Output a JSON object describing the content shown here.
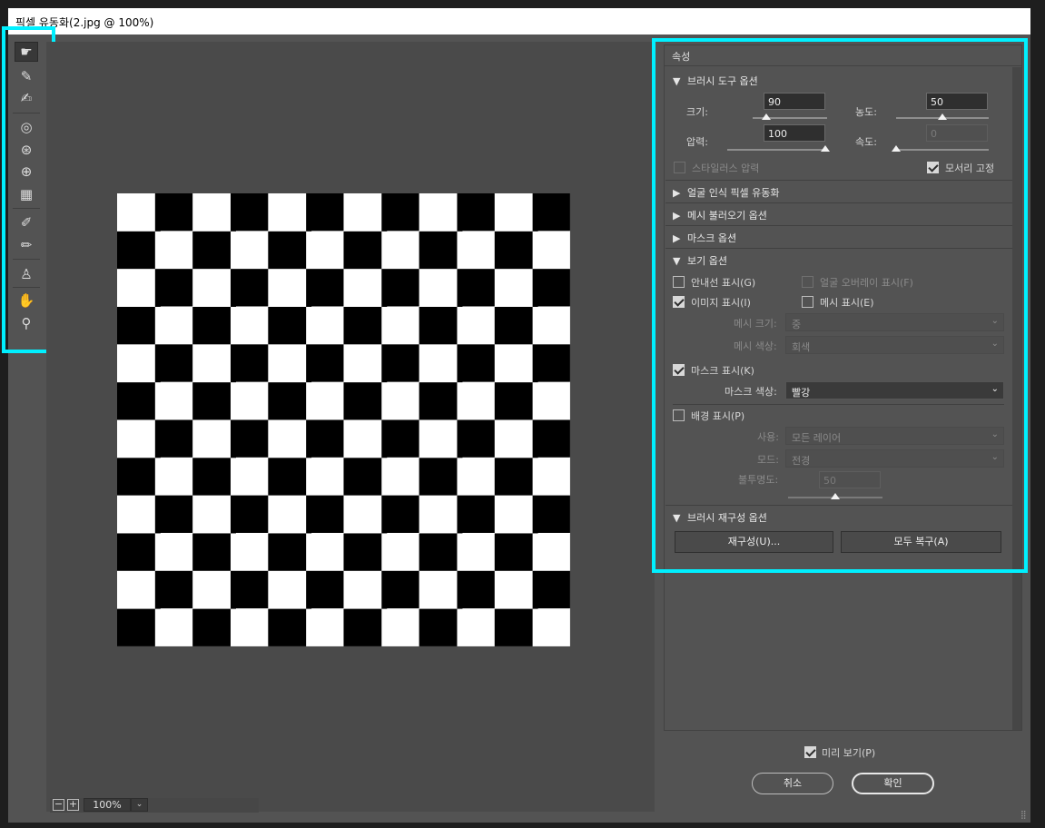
{
  "window": {
    "title": "픽셀 유동화(2.jpg @ 100%)"
  },
  "toolbar": {
    "tools": [
      {
        "icon": "forward-warp-icon",
        "glyph": "☛"
      },
      {
        "icon": "reconstruct-icon",
        "glyph": "✎"
      },
      {
        "icon": "smooth-icon",
        "glyph": "✍"
      },
      {
        "icon": "twirl-clockwise-icon",
        "glyph": "◎"
      },
      {
        "icon": "pucker-icon",
        "glyph": "⊛"
      },
      {
        "icon": "bloat-icon",
        "glyph": "⊕"
      },
      {
        "icon": "push-left-icon",
        "glyph": "▦"
      },
      {
        "icon": "freeze-mask-icon",
        "glyph": "✐"
      },
      {
        "icon": "thaw-mask-icon",
        "glyph": "✏"
      },
      {
        "icon": "face-tool-icon",
        "glyph": "♙"
      },
      {
        "icon": "hand-icon",
        "glyph": "✋"
      },
      {
        "icon": "zoom-icon",
        "glyph": "⚲"
      }
    ]
  },
  "canvas": {
    "zoom": "100%",
    "zoom_out": "−",
    "zoom_in": "+",
    "zoom_caret": "⌄"
  },
  "properties": {
    "title": "속성",
    "brush_tool": {
      "heading": "브러시 도구 옵션",
      "size_label": "크기:",
      "size_value": "90",
      "size_fraction": 0.18,
      "density_label": "농도:",
      "density_value": "50",
      "density_fraction": 0.5,
      "pressure_label": "압력:",
      "pressure_value": "100",
      "pressure_fraction": 1.0,
      "rate_label": "속도:",
      "rate_value": "0",
      "rate_fraction": 0.0,
      "stylus_label": "스타일러스 압력",
      "pin_edges_label": "모서리 고정"
    },
    "collapsed_sections": [
      {
        "label": "얼굴 인식 픽셀 유동화"
      },
      {
        "label": "메시 불러오기 옵션"
      },
      {
        "label": "마스크 옵션"
      }
    ],
    "view": {
      "heading": "보기 옵션",
      "show_guides": "안내선 표시(G)",
      "face_overlay": "얼굴 오버레이 표시(F)",
      "show_image": "이미지 표시(I)",
      "show_mesh": "메시 표시(E)",
      "mesh_size_label": "메시 크기:",
      "mesh_size_value": "중",
      "mesh_color_label": "메시 색상:",
      "mesh_color_value": "회색",
      "show_mask": "마스크 표시(K)",
      "mask_color_label": "마스크 색상:",
      "mask_color_value": "빨강",
      "show_backdrop": "배경 표시(P)",
      "use_label": "사용:",
      "use_value": "모든 레이어",
      "mode_label": "모드:",
      "mode_value": "전경",
      "opacity_label": "불투명도:",
      "opacity_value": "50",
      "opacity_fraction": 0.5
    },
    "reconstruct": {
      "heading": "브러시 재구성 옵션",
      "reconstruct_button": "재구성(U)...",
      "restore_all_button": "모두 복구(A)"
    }
  },
  "footer": {
    "preview_label": "미리 보기(P)",
    "cancel_button": "취소",
    "ok_button": "확인"
  },
  "glyphs": {
    "expanded": "▼",
    "collapsed": "▶",
    "caret": "⌄",
    "grip": "⣿"
  },
  "colors": {
    "highlight": "#00f0ff",
    "panel": "#535353",
    "canvas": "#4a4a4a"
  }
}
